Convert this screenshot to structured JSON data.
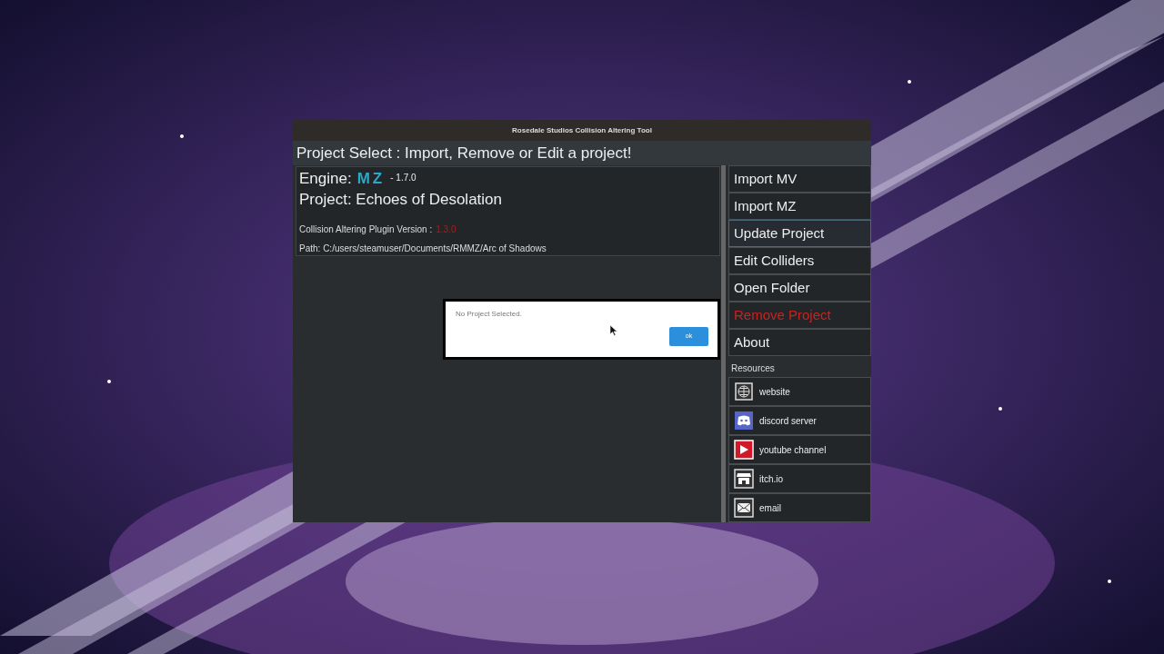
{
  "window": {
    "title": "Rosedale Studios Collision Altering Tool"
  },
  "header": "Project Select : Import, Remove or Edit a project!",
  "project": {
    "engine_label": "Engine:",
    "engine_logo": "MZ",
    "engine_version": "- 1.7.0",
    "project_line": "Project: Echoes of Desolation",
    "plugin_label": "Collision Altering Plugin Version :",
    "plugin_version": "1.3.0",
    "path": "Path: C:/users/steamuser/Documents/RMMZ/Arc of Shadows"
  },
  "actions": [
    {
      "label": "Import MV",
      "kind": "normal",
      "focused": false
    },
    {
      "label": "Import MZ",
      "kind": "normal",
      "focused": false
    },
    {
      "label": "Update Project",
      "kind": "normal",
      "focused": true
    },
    {
      "label": "Edit Colliders",
      "kind": "normal",
      "focused": false
    },
    {
      "label": "Open Folder",
      "kind": "normal",
      "focused": false
    },
    {
      "label": "Remove Project",
      "kind": "danger",
      "focused": false
    },
    {
      "label": "About",
      "kind": "normal",
      "focused": false
    }
  ],
  "resources": {
    "title": "Resources",
    "items": [
      {
        "label": "website",
        "kind": "globe"
      },
      {
        "label": "discord server",
        "kind": "discord"
      },
      {
        "label": "youtube channel",
        "kind": "youtube"
      },
      {
        "label": "itch.io",
        "kind": "store"
      },
      {
        "label": "email",
        "kind": "mail"
      }
    ]
  },
  "dialog": {
    "message": "No Project Selected.",
    "button": "ok"
  }
}
